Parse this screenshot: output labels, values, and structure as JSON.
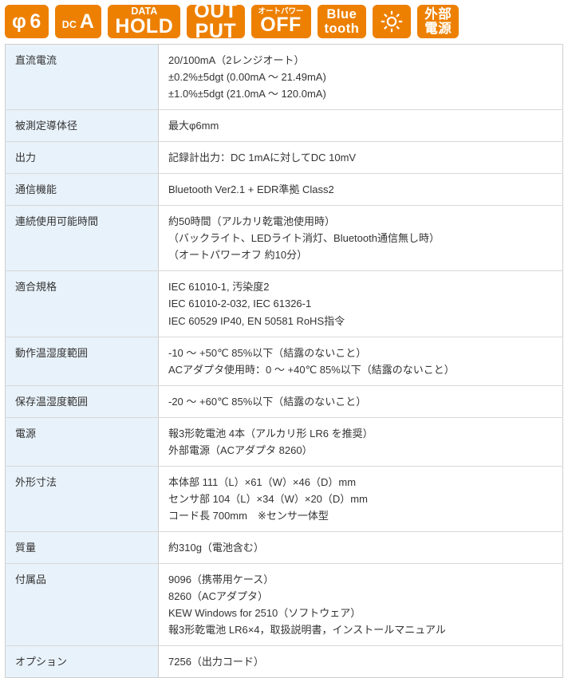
{
  "badges": [
    {
      "id": "phi6",
      "type": "inline",
      "parts": [
        {
          "text": "φ",
          "size": "big"
        },
        {
          "text": "6",
          "size": "big"
        }
      ],
      "name": "badge-conductor-diameter-phi6"
    },
    {
      "id": "dc-a",
      "type": "inline",
      "parts": [
        {
          "text": "DC",
          "size": "small"
        },
        {
          "text": "A",
          "size": "big"
        }
      ],
      "name": "badge-dc-ampere"
    },
    {
      "id": "data-hold",
      "type": "stack",
      "parts": [
        {
          "text": "DATA",
          "size": "small"
        },
        {
          "text": "HOLD",
          "size": "big"
        }
      ],
      "name": "badge-data-hold"
    },
    {
      "id": "output",
      "type": "stack",
      "parts": [
        {
          "text": "OUT",
          "size": "big"
        },
        {
          "text": "PUT",
          "size": "big"
        }
      ],
      "name": "badge-output"
    },
    {
      "id": "auto-power-off",
      "type": "stack",
      "parts": [
        {
          "text": "オートパワー",
          "size": "tiny"
        },
        {
          "text": "OFF",
          "size": "big"
        }
      ],
      "name": "badge-auto-power-off"
    },
    {
      "id": "bluetooth",
      "type": "stack",
      "parts": [
        {
          "text": "Blue",
          "size": "mid"
        },
        {
          "text": "tooth",
          "size": "mid"
        }
      ],
      "name": "badge-bluetooth"
    },
    {
      "id": "backlight",
      "type": "icon",
      "icon": "sun-icon",
      "parts": [],
      "name": "badge-backlight"
    },
    {
      "id": "external-power",
      "type": "stack",
      "parts": [
        {
          "text": "外部",
          "size": "mid"
        },
        {
          "text": "電源",
          "size": "mid"
        }
      ],
      "name": "badge-external-power"
    }
  ],
  "colors": {
    "badge_orange": "#ED8000",
    "label_cell_bg": "#E8F2FA",
    "table_border": "#cfcfcf",
    "text": "#333333"
  },
  "spec_table": {
    "rows": [
      {
        "label": "直流電流",
        "lines": [
          "20/100mA（2レンジオート）",
          "±0.2%±5dgt (0.00mA ～ 21.49mA)",
          "±1.0%±5dgt (21.0mA ～ 120.0mA)"
        ]
      },
      {
        "label": "被測定導体径",
        "lines": [
          "最大φ6mm"
        ]
      },
      {
        "label": "出力",
        "lines": [
          "記録計出力：DC 1mAに対してDC 10mV"
        ]
      },
      {
        "label": "通信機能",
        "lines": [
          "Bluetooth Ver2.1 + EDR準拠 Class2"
        ]
      },
      {
        "label": "連続使用可能時間",
        "lines": [
          "約50時間（アルカリ乾電池使用時）",
          "（バックライト、LEDライト消灯、Bluetooth通信無し時）",
          "（オートパワーオフ 約10分）"
        ]
      },
      {
        "label": "適合規格",
        "lines": [
          "IEC 61010-1, 汚染度2",
          "IEC 61010-2-032, IEC 61326-1",
          "IEC 60529 IP40, EN 50581 RoHS指令"
        ]
      },
      {
        "label": "動作温湿度範囲",
        "lines": [
          "-10 ～ +50℃ 85%以下（結露のないこと）",
          "ACアダプタ使用時：0 ～ +40℃ 85%以下（結露のないこと）"
        ]
      },
      {
        "label": "保存温湿度範囲",
        "lines": [
          "-20 ～ +60℃ 85%以下（結露のないこと）"
        ]
      },
      {
        "label": "電源",
        "lines": [
          "報3形乾電池 4本（アルカリ形 LR6 を推奨）",
          "外部電源（ACアダプタ 8260）"
        ]
      },
      {
        "label": "外形寸法",
        "lines": [
          "本体部 111（L）×61（W）×46（D）mm",
          "センサ部 104（L）×34（W）×20（D）mm",
          "コード長 700mm　※センサ一体型"
        ]
      },
      {
        "label": "質量",
        "lines": [
          "約310g（電池含む）"
        ]
      },
      {
        "label": "付属品",
        "lines": [
          "9096（携帯用ケース）",
          "8260（ACアダプタ）",
          "KEW Windows for 2510（ソフトウェア）",
          "報3形乾電池 LR6×4，取扱説明書，インストールマニュアル"
        ]
      },
      {
        "label": "オプション",
        "lines": [
          "7256（出力コード）"
        ]
      }
    ]
  }
}
